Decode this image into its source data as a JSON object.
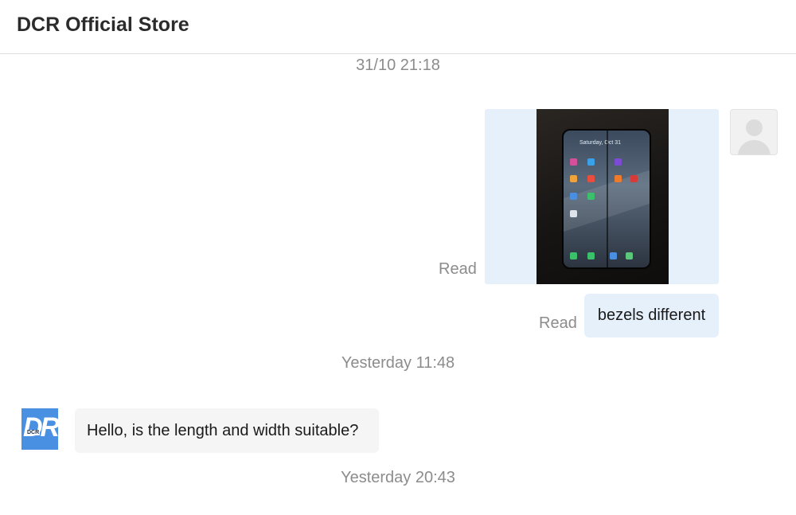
{
  "header": {
    "title": "DCR Official Store"
  },
  "chat": {
    "timestamps": [
      "31/10 21:18",
      "Yesterday 11:48",
      "Yesterday 20:43"
    ],
    "messages": [
      {
        "sender": "me",
        "type": "image",
        "status": "Read",
        "image_date_text": "Saturday, Oct 31"
      },
      {
        "sender": "me",
        "type": "text",
        "status": "Read",
        "text": "bezels different"
      },
      {
        "sender": "store",
        "type": "text",
        "text": "Hello, is the length and width suitable?"
      }
    ]
  },
  "store_avatar": {
    "logo": "DR",
    "logo_small": "DCR"
  },
  "colors": {
    "outgoing_bubble": "#e6f0fb",
    "incoming_bubble": "#f5f5f5",
    "store_brand": "#4a90e2",
    "meta_text": "#8c8c8c"
  }
}
